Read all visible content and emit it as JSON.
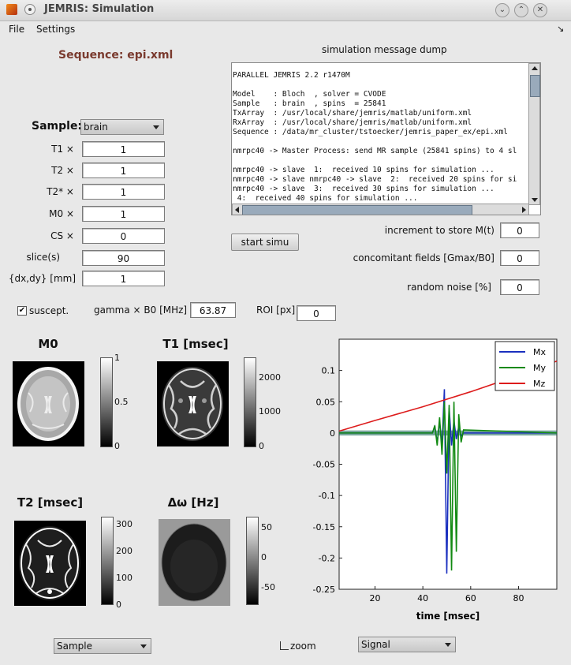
{
  "window": {
    "title": "JEMRIS: Simulation",
    "minimize_glyph": "⌄",
    "maximize_glyph": "⌃",
    "close_glyph": "✕"
  },
  "menu": {
    "file": "File",
    "settings": "Settings",
    "corner_glyph": "↘"
  },
  "sequence": {
    "label": "Sequence: epi.xml",
    "color": "#7a3a2e"
  },
  "dump": {
    "title": "simulation message dump",
    "lines": [
      "PARALLEL JEMRIS 2.2 r1470M",
      "",
      "Model    : Bloch  , solver = CVODE",
      "Sample   : brain  , spins  = 25841",
      "TxArray  : /usr/local/share/jemris/matlab/uniform.xml",
      "RxArray  : /usr/local/share/jemris/matlab/uniform.xml",
      "Sequence : /data/mr_cluster/tstoecker/jemris_paper_ex/epi.xml",
      "",
      "nmrpc40 -> Master Process: send MR sample (25841 spins) to 4 sl",
      "",
      "nmrpc40 -> slave  1:  received 10 spins for simulation ...",
      "nmrpc40 -> slave nmrpc40 -> slave  2:  received 20 spins for si",
      "nmrpc40 -> slave  3:  received 30 spins for simulation ...",
      " 4:  received 40 spins for simulation ..."
    ]
  },
  "sample": {
    "label": "Sample:",
    "selected": "brain",
    "fields": [
      {
        "label": "T1 ×",
        "value": "1"
      },
      {
        "label": "T2 ×",
        "value": "1"
      },
      {
        "label": "T2* ×",
        "value": "1"
      },
      {
        "label": "M0 ×",
        "value": "1"
      },
      {
        "label": "CS ×",
        "value": "0"
      },
      {
        "label": "slice(s)",
        "value": "90"
      },
      {
        "label": "{dx,dy} [mm]",
        "value": "1"
      }
    ]
  },
  "start_button": "start simu",
  "options": [
    {
      "label": "increment to store M(t)",
      "value": "0"
    },
    {
      "label": "concomitant fields [Gmax/B0]",
      "value": "0"
    },
    {
      "label": "random noise [%]",
      "value": "0"
    }
  ],
  "suscept": {
    "label": "suscept.",
    "checked": true
  },
  "gamma": {
    "label": "gamma × B0 [MHz]",
    "value": "63.87"
  },
  "roi": {
    "label": "ROI [px]",
    "value": "0"
  },
  "images": {
    "m0": {
      "title": "M0",
      "ticks": [
        "1",
        "0.5",
        "0"
      ]
    },
    "t1": {
      "title": "T1 [msec]",
      "ticks": [
        "2000",
        "1000",
        "0"
      ]
    },
    "t2": {
      "title": "T2 [msec]",
      "ticks": [
        "300",
        "200",
        "100",
        "0"
      ]
    },
    "dw": {
      "title": "Δω [Hz]",
      "ticks": [
        "50",
        "0",
        "-50"
      ]
    }
  },
  "bottom": {
    "left_select": "Sample",
    "zoom_label": "zoom",
    "right_select": "Signal"
  },
  "chart_data": {
    "type": "line",
    "xlabel": "time [msec]",
    "ylabel": "",
    "xlim": [
      5,
      96
    ],
    "ylim": [
      -0.25,
      0.15
    ],
    "x_ticks": [
      "20",
      "40",
      "60",
      "80"
    ],
    "y_ticks": [
      "0.1",
      "0.05",
      "0",
      "-0.05",
      "-0.1",
      "-0.15",
      "-0.2",
      "-0.25"
    ],
    "legend": "top-right",
    "series": [
      {
        "name": "Mx",
        "color": "#1a2fbf",
        "x": [
          5,
          44,
          45,
          46,
          47,
          48,
          49,
          50,
          51,
          52,
          53,
          54,
          55,
          56,
          57,
          96
        ],
        "y": [
          0,
          0,
          0.01,
          -0.015,
          0.018,
          -0.02,
          0.07,
          -0.225,
          0.04,
          -0.02,
          0.02,
          -0.01,
          0.01,
          -0.005,
          0,
          0
        ]
      },
      {
        "name": "My",
        "color": "#128a12",
        "x": [
          5,
          44,
          45,
          46,
          47,
          48,
          49,
          50,
          51,
          52,
          53,
          54,
          55,
          56,
          57,
          96
        ],
        "y": [
          0,
          0,
          0.012,
          -0.02,
          0.025,
          -0.035,
          0.05,
          -0.065,
          0.045,
          -0.22,
          0.05,
          -0.19,
          0.03,
          -0.015,
          0.005,
          0
        ]
      },
      {
        "name": "Mz",
        "color": "#dd1c1c",
        "x": [
          5,
          20,
          40,
          60,
          80,
          96
        ],
        "y": [
          0.003,
          0.02,
          0.042,
          0.066,
          0.092,
          0.115
        ]
      }
    ]
  }
}
